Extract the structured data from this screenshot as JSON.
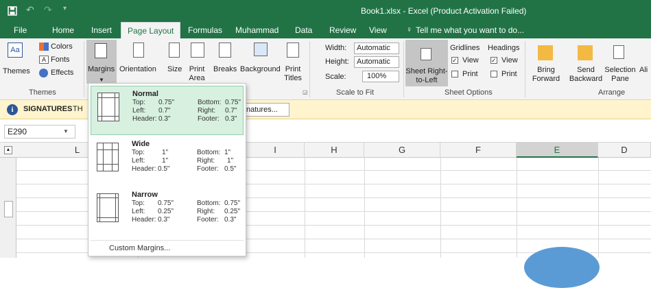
{
  "title": "Book1.xlsx - Excel (Product Activation Failed)",
  "colors": {
    "brand": "#217346",
    "selected": "#d7f0e0",
    "warning": "#fff4ce"
  },
  "tabs": [
    "File",
    "Home",
    "Insert",
    "Page Layout",
    "Formulas",
    "Muhammad",
    "Data",
    "Review",
    "View"
  ],
  "tell_me": "Tell me what you want to do...",
  "ribbon": {
    "themes": {
      "themes": "Themes",
      "colors": "Colors",
      "fonts": "Fonts",
      "effects": "Effects",
      "group": "Themes"
    },
    "page_setup": {
      "margins": "Margins",
      "orientation": "Orientation",
      "size": "Size",
      "print_area": "Print Area",
      "breaks": "Breaks",
      "background": "Background",
      "print_titles": "Print Titles"
    },
    "scale": {
      "width_label": "Width:",
      "width_value": "Automatic",
      "height_label": "Height:",
      "height_value": "Automatic",
      "scale_label": "Scale:",
      "scale_value": "100%",
      "group": "Scale to Fit"
    },
    "sheet_options": {
      "sheet_rtl": "Sheet Right-to-Left",
      "gridlines": "Gridlines",
      "headings": "Headings",
      "view": "View",
      "print": "Print",
      "group": "Sheet Options"
    },
    "arrange": {
      "bring_forward": "Bring Forward",
      "send_backward": "Send Backward",
      "selection_pane": "Selection Pane",
      "align": "Ali",
      "group": "Arrange"
    }
  },
  "message_bar": {
    "title": "SIGNATURES",
    "text": "TH",
    "button": "natures..."
  },
  "name_box": "E290",
  "columns": [
    "L",
    "I",
    "H",
    "G",
    "F",
    "E",
    "D"
  ],
  "margins_menu": {
    "items": [
      {
        "name": "Normal",
        "top_l": "Top:",
        "top": "0.75\"",
        "bottom_l": "Bottom:",
        "bottom": "0.75\"",
        "left_l": "Left:",
        "left": "0.7\"",
        "right_l": "Right:",
        "right": "0.7\"",
        "header_l": "Header:",
        "header": "0.3\"",
        "footer_l": "Footer:",
        "footer": "0.3\""
      },
      {
        "name": "Wide",
        "top_l": "Top:",
        "top": "1\"",
        "bottom_l": "Bottom:",
        "bottom": "1\"",
        "left_l": "Left:",
        "left": "1\"",
        "right_l": "Right:",
        "right": "1\"",
        "header_l": "Header:",
        "header": "0.5\"",
        "footer_l": "Footer:",
        "footer": "0.5\""
      },
      {
        "name": "Narrow",
        "top_l": "Top:",
        "top": "0.75\"",
        "bottom_l": "Bottom:",
        "bottom": "0.75\"",
        "left_l": "Left:",
        "left": "0.25\"",
        "right_l": "Right:",
        "right": "0.25\"",
        "header_l": "Header:",
        "header": "0.3\"",
        "footer_l": "Footer:",
        "footer": "0.3\""
      }
    ],
    "custom": "Custom Margins..."
  }
}
